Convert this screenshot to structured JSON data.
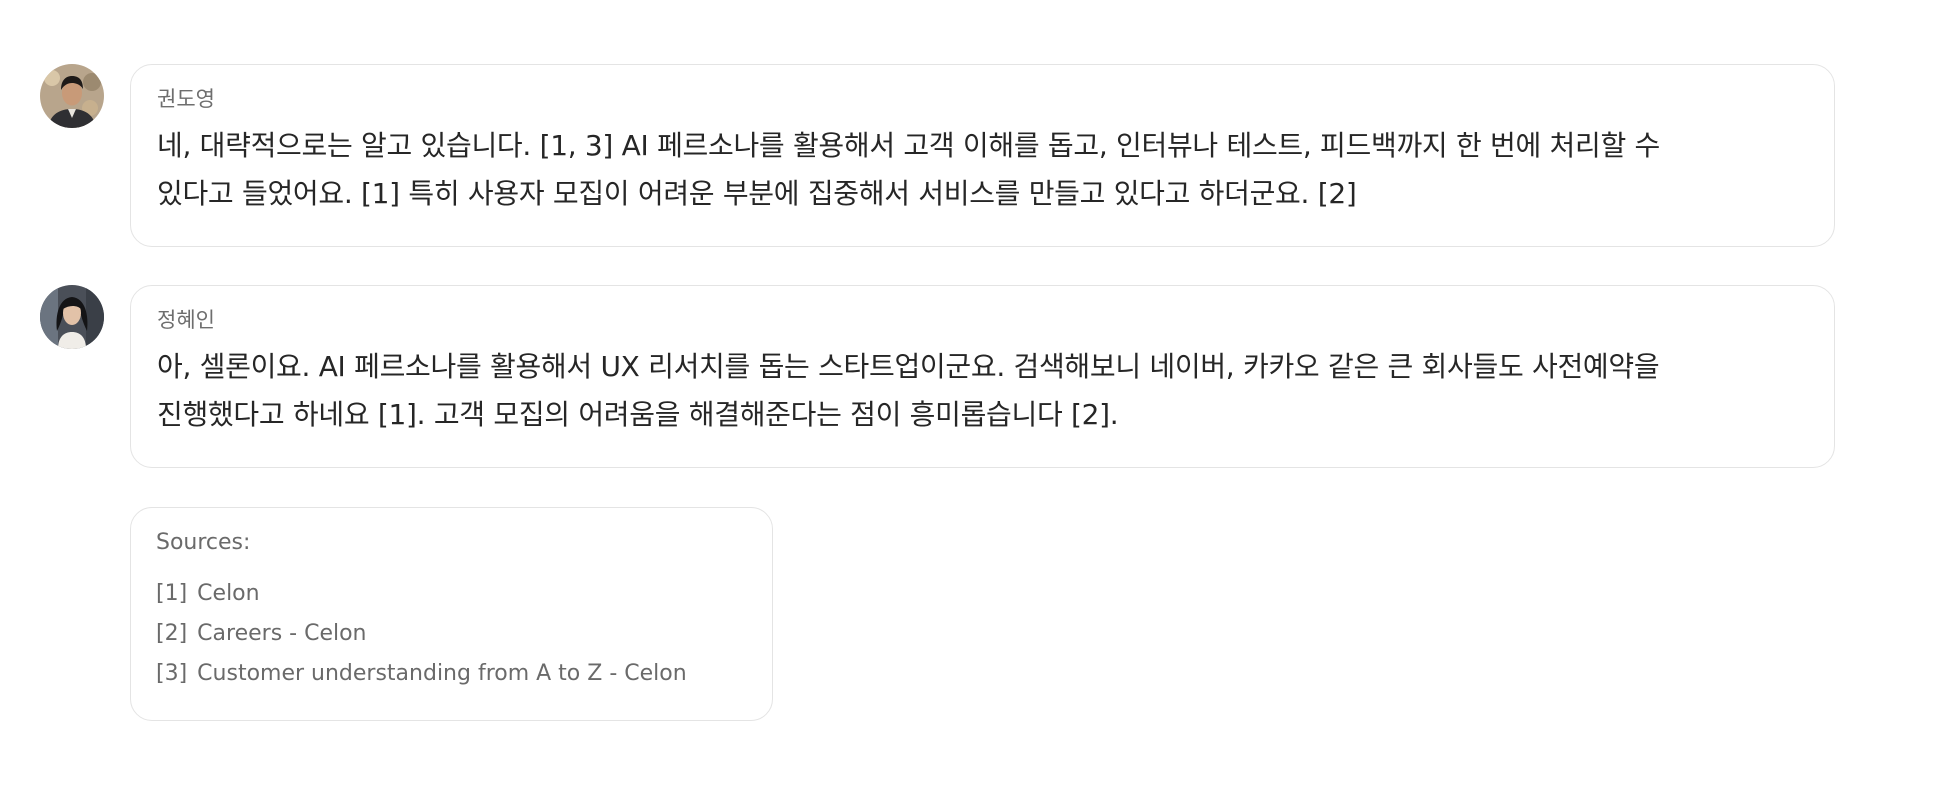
{
  "messages": [
    {
      "author": "권도영",
      "avatar_icon": "avatar-man-photo",
      "lines": [
        "네, 대략적으로는 알고 있습니다. [1, 3] AI 페르소나를 활용해서 고객 이해를 돕고, 인터뷰나 테스트, 피드백까지 한 번에 처리할 수",
        "있다고 들었어요. [1] 특히 사용자 모집이 어려운 부분에 집중해서 서비스를 만들고 있다고 하더군요. [2]"
      ]
    },
    {
      "author": "정혜인",
      "avatar_icon": "avatar-woman-photo",
      "lines": [
        "아, 셀론이요. AI 페르소나를 활용해서 UX 리서치를 돕는 스타트업이군요. 검색해보니 네이버, 카카오 같은 큰 회사들도 사전예약을",
        "진행했다고 하네요 [1]. 고객 모집의 어려움을 해결해준다는 점이 흥미롭습니다 [2]."
      ]
    }
  ],
  "sources": {
    "title": "Sources:",
    "items": [
      {
        "index": "[1]",
        "label": "Celon"
      },
      {
        "index": "[2]",
        "label": "Careers - Celon"
      },
      {
        "index": "[3]",
        "label": "Customer understanding from A to Z - Celon"
      }
    ]
  },
  "colors": {
    "border": "#e4e4e4",
    "text": "#262626",
    "muted": "#6a6a6a"
  }
}
